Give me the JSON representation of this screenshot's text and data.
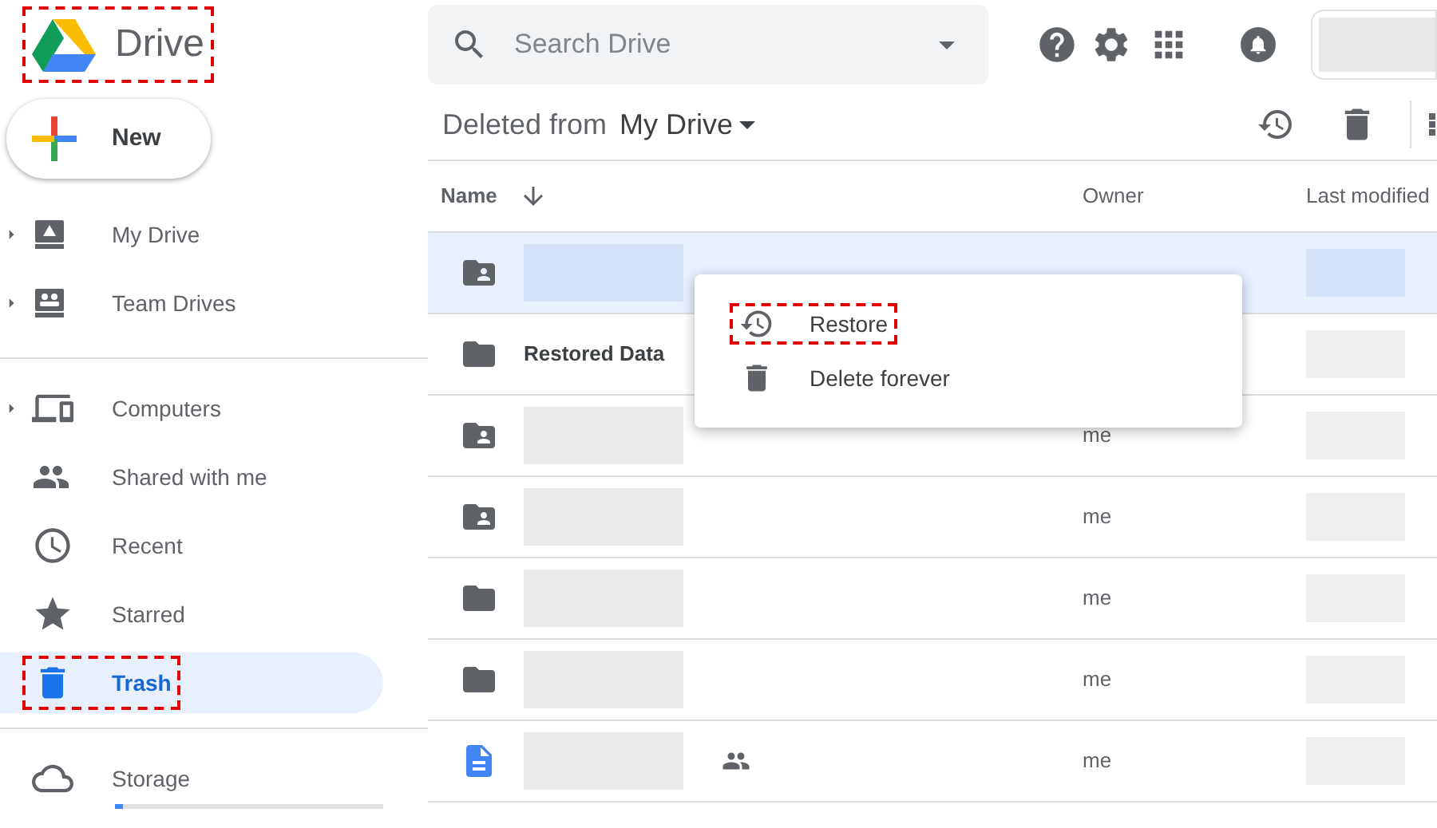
{
  "logo": {
    "text": "Drive",
    "annotated": true
  },
  "search": {
    "placeholder": "Search Drive"
  },
  "new_button": {
    "label": "New"
  },
  "sidebar": {
    "sections": [
      {
        "items": [
          {
            "kind": "my-drive",
            "label": "My Drive",
            "expandable": true,
            "selected": false,
            "annotated": false
          },
          {
            "kind": "team-drives",
            "label": "Team Drives",
            "expandable": true,
            "selected": false,
            "annotated": false
          }
        ]
      },
      {
        "items": [
          {
            "kind": "computers",
            "label": "Computers",
            "expandable": true,
            "selected": false,
            "annotated": false
          },
          {
            "kind": "shared",
            "label": "Shared with me",
            "expandable": false,
            "selected": false,
            "annotated": false
          },
          {
            "kind": "recent",
            "label": "Recent",
            "expandable": false,
            "selected": false,
            "annotated": false
          },
          {
            "kind": "starred",
            "label": "Starred",
            "expandable": false,
            "selected": false,
            "annotated": false
          },
          {
            "kind": "trash",
            "label": "Trash",
            "expandable": false,
            "selected": true,
            "annotated": true
          }
        ]
      },
      {
        "items": [
          {
            "kind": "storage",
            "label": "Storage",
            "expandable": false,
            "selected": false,
            "annotated": false,
            "level": 0.03
          }
        ]
      }
    ]
  },
  "breadcrumb": {
    "prefix": "Deleted from",
    "location": "My Drive"
  },
  "table": {
    "columns": [
      "Name",
      "Owner",
      "Last modified"
    ],
    "rows": [
      {
        "kind": "shared-folder",
        "selected": true
      },
      {
        "kind": "folder",
        "name": "Restored Data",
        "selected": false
      },
      {
        "kind": "shared-folder",
        "owner": "me",
        "selected": false
      },
      {
        "kind": "shared-folder",
        "owner": "me",
        "selected": false
      },
      {
        "kind": "folder",
        "owner": "me",
        "selected": false
      },
      {
        "kind": "folder",
        "owner": "me",
        "selected": false
      },
      {
        "kind": "doc",
        "shared": true,
        "owner": "me",
        "selected": false
      }
    ]
  },
  "context_menu": {
    "items": [
      {
        "kind": "restore",
        "label": "Restore",
        "annotated": true
      },
      {
        "kind": "delete",
        "label": "Delete forever",
        "annotated": false
      }
    ]
  }
}
